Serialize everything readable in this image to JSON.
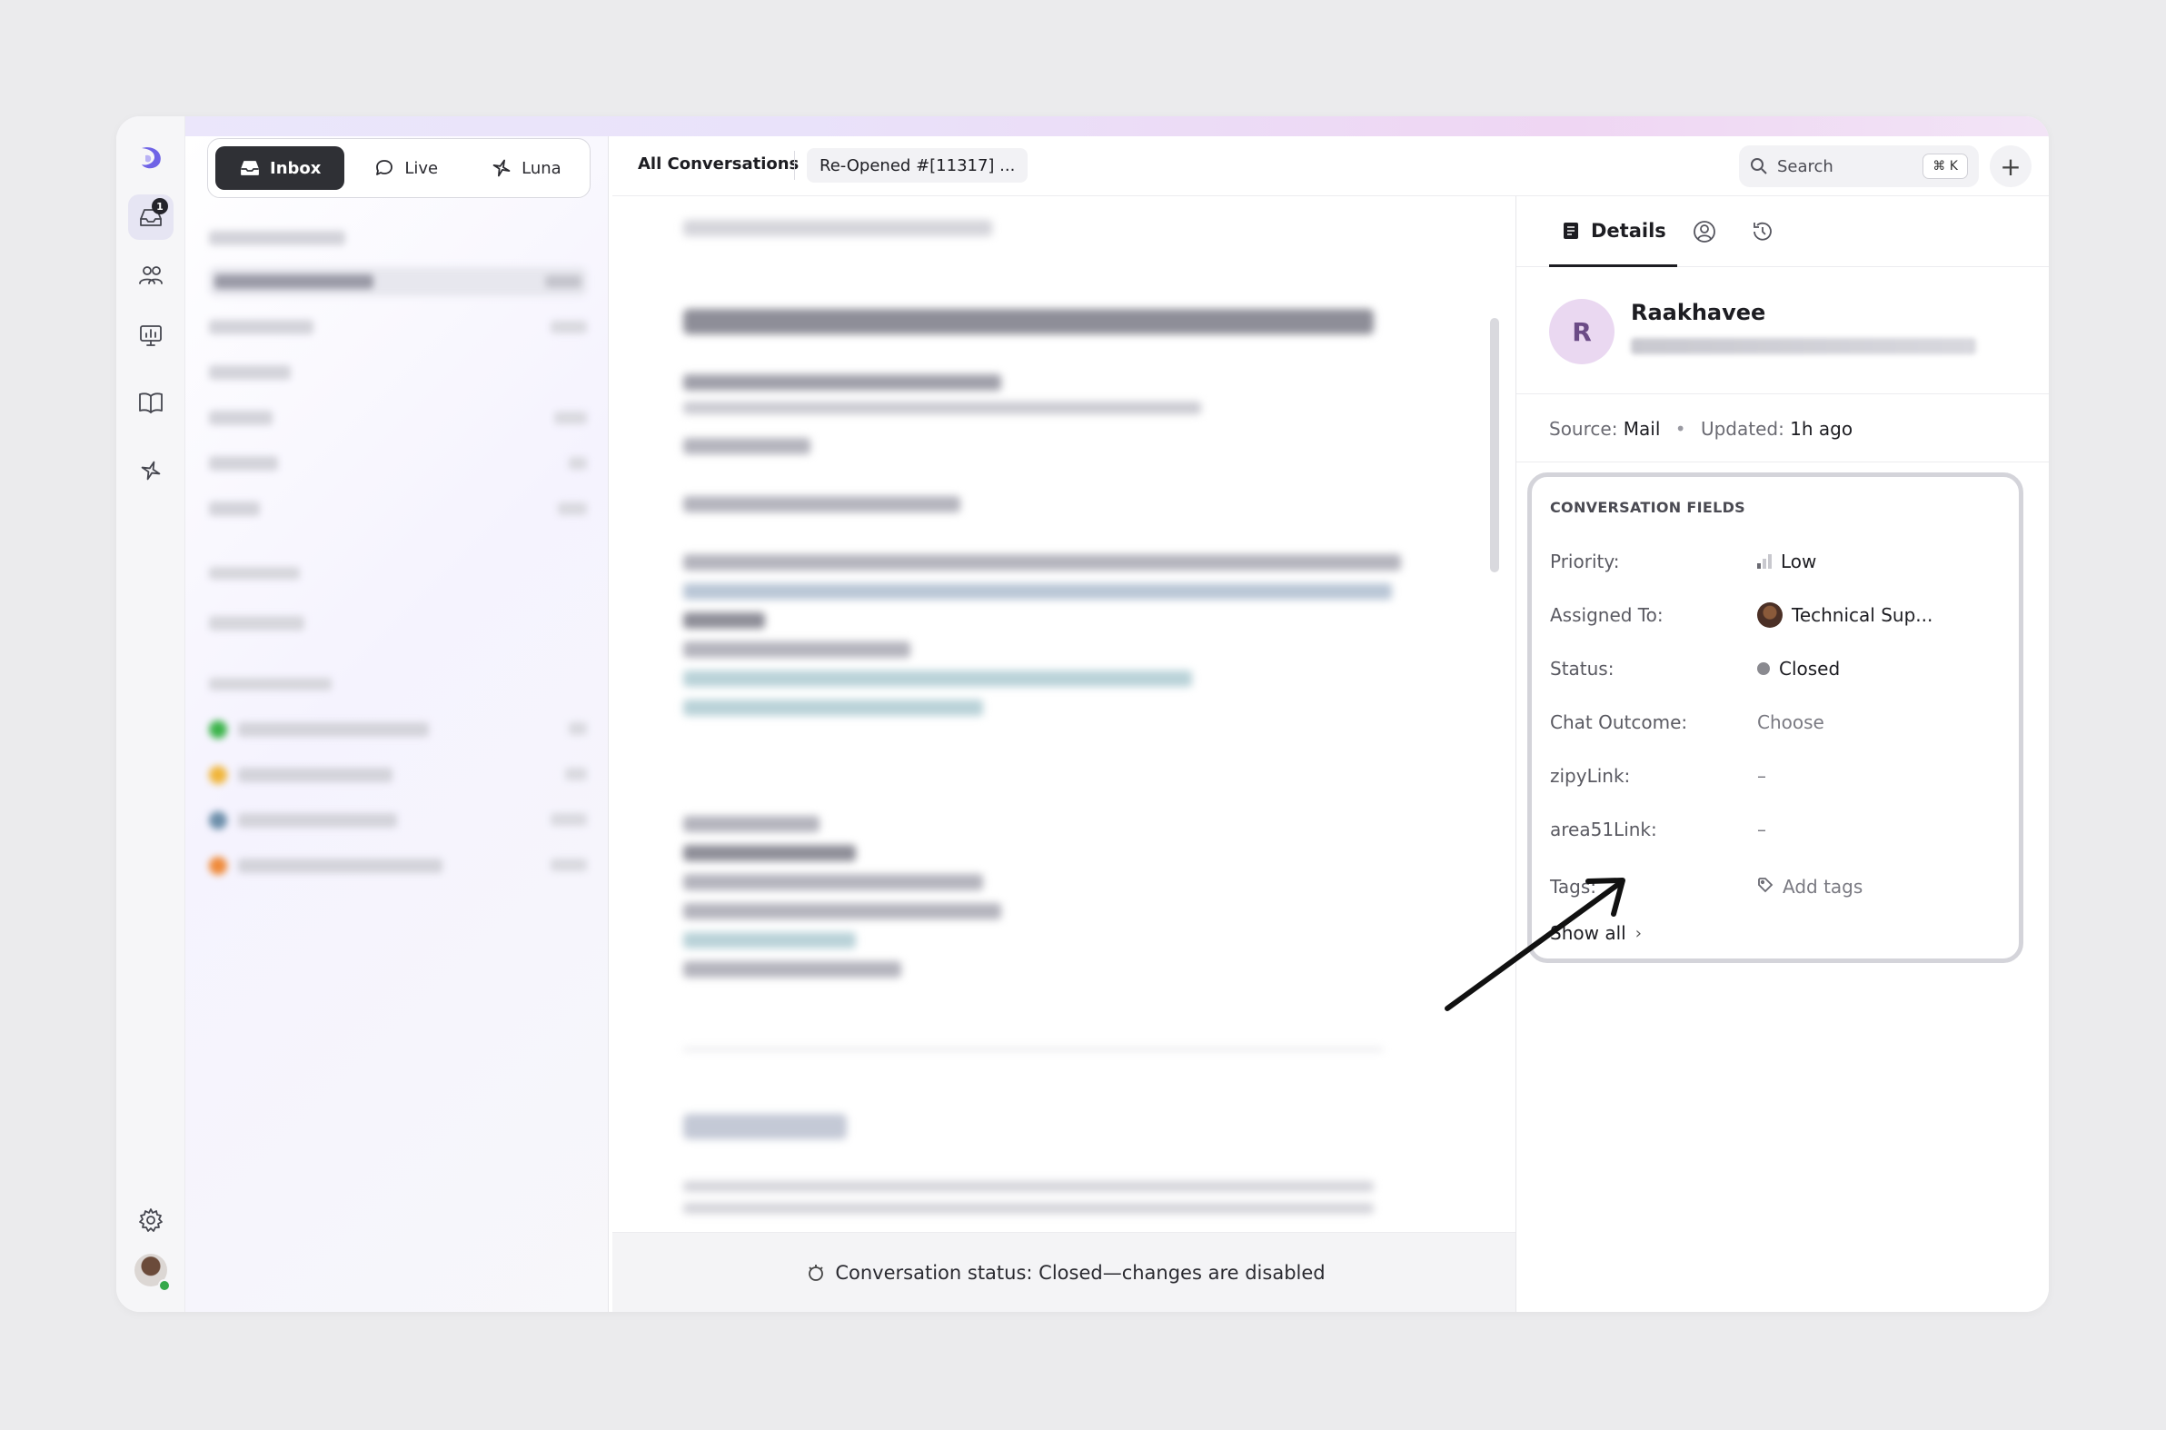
{
  "nav": {
    "segments": [
      {
        "label": "Inbox",
        "icon": "inbox-icon",
        "active": true
      },
      {
        "label": "Live",
        "icon": "chat-bubble-icon",
        "active": false
      },
      {
        "label": "Luna",
        "icon": "sparkle-icon",
        "active": false
      }
    ]
  },
  "rail": {
    "inbox_badge": "1"
  },
  "main": {
    "tab_all": "All Conversations",
    "tab_current": "Re-Opened #[11317] ...",
    "search_placeholder": "Search",
    "search_shortcut": "⌘ K",
    "status_message": "Conversation status: Closed—changes are disabled"
  },
  "details": {
    "tab_label": "Details",
    "contact": {
      "initial": "R",
      "name": "Raakhavee"
    },
    "meta": {
      "source_label": "Source:",
      "source_value": "Mail",
      "updated_label": "Updated:",
      "updated_value": "1h ago"
    },
    "fields": {
      "heading": "CONVERSATION FIELDS",
      "priority_label": "Priority:",
      "priority_value": "Low",
      "assigned_label": "Assigned To:",
      "assigned_value": "Technical Sup...",
      "status_label": "Status:",
      "status_value": "Closed",
      "outcome_label": "Chat Outcome:",
      "outcome_value": "Choose",
      "zipy_label": "zipyLink:",
      "zipy_value": "–",
      "area51_label": "area51Link:",
      "area51_value": "–",
      "tags_label": "Tags:",
      "tags_value": "Add tags",
      "show_all": "Show all"
    }
  }
}
